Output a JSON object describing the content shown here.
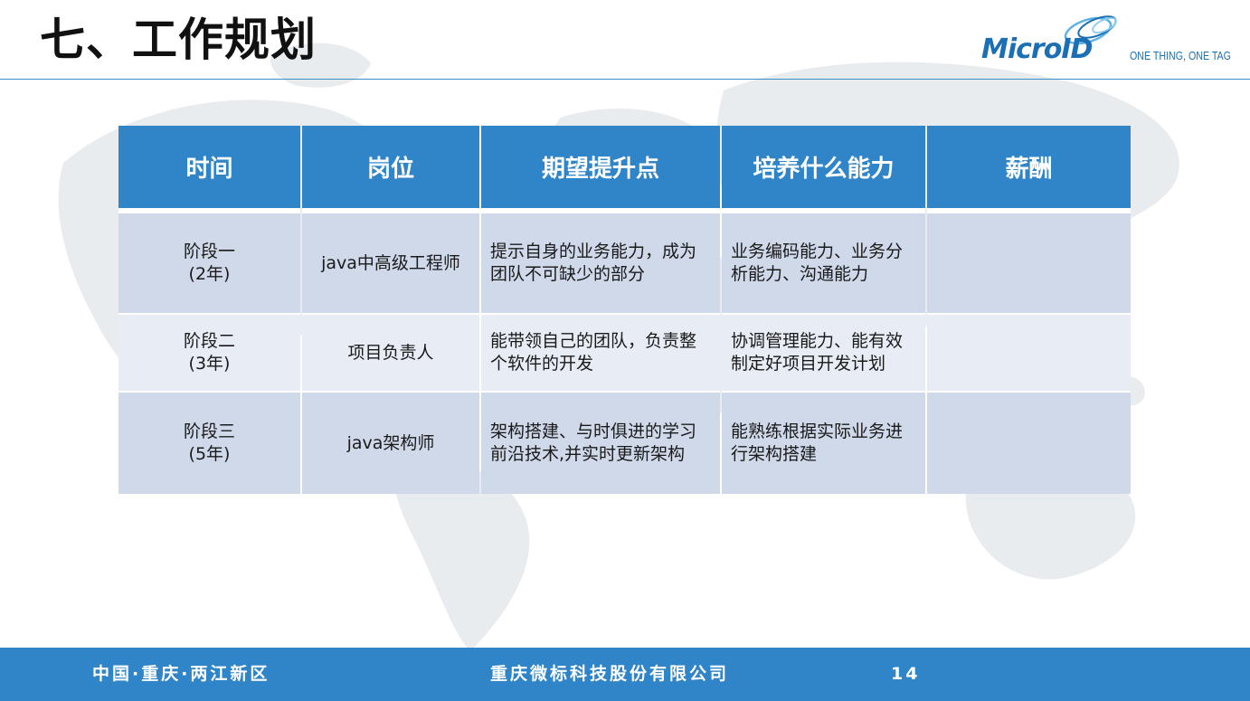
{
  "slide": {
    "title": "七、工作规划"
  },
  "brand": {
    "logo_text": "MicroID",
    "tagline": "ONE THING, ONE TAG",
    "color_primary": "#2f85c7",
    "color_logo": "#1b6fb5"
  },
  "table": {
    "headers": [
      "时间",
      "岗位",
      "期望提升点",
      "培养什么能力",
      "薪酬"
    ],
    "rows": [
      {
        "stage": "阶段一",
        "years": "(2年)",
        "position": "java中高级工程师",
        "improvement": "提示自身的业务能力，成为团队不可缺少的部分",
        "ability": "业务编码能力、业务分析能力、沟通能力",
        "salary": ""
      },
      {
        "stage": "阶段二",
        "years": "(3年)",
        "position": "项目负责人",
        "improvement": "能带领自己的团队，负责整个软件的开发",
        "ability": "协调管理能力、能有效制定好项目开发计划",
        "salary": ""
      },
      {
        "stage": "阶段三",
        "years": "(5年)",
        "position": "java架构师",
        "improvement": "架构搭建、与时俱进的学习前沿技术,并实时更新架构",
        "ability": "能熟练根据实际业务进行架构搭建",
        "salary": ""
      }
    ]
  },
  "footer": {
    "location": "中国·重庆·两江新区",
    "company": "重庆微标科技股份有限公司",
    "page_number": "14"
  }
}
